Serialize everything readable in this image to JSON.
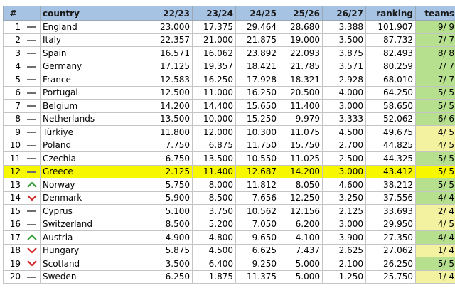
{
  "headers": {
    "num": "#",
    "country": "country",
    "y1": "22/23",
    "y2": "23/24",
    "y3": "24/25",
    "y4": "25/26",
    "y5": "26/27",
    "ranking": "ranking",
    "teams": "teams"
  },
  "rows": [
    {
      "num": "1",
      "trend": "same",
      "country": "England",
      "y1": "23.000",
      "y2": "17.375",
      "y3": "29.464",
      "y4": "28.680",
      "y5": "3.388",
      "ranking": "101.907",
      "teams": "9/ 9",
      "teams_status": "full"
    },
    {
      "num": "2",
      "trend": "same",
      "country": "Italy",
      "y1": "22.357",
      "y2": "21.000",
      "y3": "21.875",
      "y4": "19.000",
      "y5": "3.500",
      "ranking": "87.732",
      "teams": "7/ 7",
      "teams_status": "full"
    },
    {
      "num": "3",
      "trend": "same",
      "country": "Spain",
      "y1": "16.571",
      "y2": "16.062",
      "y3": "23.892",
      "y4": "22.093",
      "y5": "3.875",
      "ranking": "82.493",
      "teams": "8/ 8",
      "teams_status": "full"
    },
    {
      "num": "4",
      "trend": "same",
      "country": "Germany",
      "y1": "17.125",
      "y2": "19.357",
      "y3": "18.421",
      "y4": "21.785",
      "y5": "3.571",
      "ranking": "80.259",
      "teams": "7/ 7",
      "teams_status": "full"
    },
    {
      "num": "5",
      "trend": "same",
      "country": "France",
      "y1": "12.583",
      "y2": "16.250",
      "y3": "17.928",
      "y4": "18.321",
      "y5": "2.928",
      "ranking": "68.010",
      "teams": "7/ 7",
      "teams_status": "full"
    },
    {
      "num": "6",
      "trend": "same",
      "country": "Portugal",
      "y1": "12.500",
      "y2": "11.000",
      "y3": "16.250",
      "y4": "20.500",
      "y5": "4.000",
      "ranking": "64.250",
      "teams": "5/ 5",
      "teams_status": "full"
    },
    {
      "num": "7",
      "trend": "same",
      "country": "Belgium",
      "y1": "14.200",
      "y2": "14.400",
      "y3": "15.650",
      "y4": "11.400",
      "y5": "3.000",
      "ranking": "58.650",
      "teams": "5/ 5",
      "teams_status": "full"
    },
    {
      "num": "8",
      "trend": "same",
      "country": "Netherlands",
      "y1": "13.500",
      "y2": "10.000",
      "y3": "15.250",
      "y4": "9.979",
      "y5": "3.333",
      "ranking": "52.062",
      "teams": "6/ 6",
      "teams_status": "full"
    },
    {
      "num": "9",
      "trend": "same",
      "country": "Türkiye",
      "y1": "11.800",
      "y2": "12.000",
      "y3": "10.300",
      "y4": "11.075",
      "y5": "4.500",
      "ranking": "49.675",
      "teams": "4/ 5",
      "teams_status": "part"
    },
    {
      "num": "10",
      "trend": "same",
      "country": "Poland",
      "y1": "7.750",
      "y2": "6.875",
      "y3": "11.750",
      "y4": "15.750",
      "y5": "2.700",
      "ranking": "44.825",
      "teams": "4/ 5",
      "teams_status": "part"
    },
    {
      "num": "11",
      "trend": "same",
      "country": "Czechia",
      "y1": "6.750",
      "y2": "13.500",
      "y3": "10.550",
      "y4": "11.025",
      "y5": "2.500",
      "ranking": "44.325",
      "teams": "5/ 5",
      "teams_status": "full"
    },
    {
      "num": "12",
      "trend": "same",
      "country": "Greece",
      "y1": "2.125",
      "y2": "11.400",
      "y3": "12.687",
      "y4": "14.200",
      "y5": "3.000",
      "ranking": "43.412",
      "teams": "5/ 5",
      "teams_status": "full",
      "highlight": true
    },
    {
      "num": "13",
      "trend": "up",
      "country": "Norway",
      "y1": "5.750",
      "y2": "8.000",
      "y3": "11.812",
      "y4": "8.050",
      "y5": "4.600",
      "ranking": "38.212",
      "teams": "5/ 5",
      "teams_status": "full"
    },
    {
      "num": "14",
      "trend": "down",
      "country": "Denmark",
      "y1": "5.900",
      "y2": "8.500",
      "y3": "7.656",
      "y4": "12.250",
      "y5": "3.250",
      "ranking": "37.556",
      "teams": "4/ 4",
      "teams_status": "full"
    },
    {
      "num": "15",
      "trend": "same",
      "country": "Cyprus",
      "y1": "5.100",
      "y2": "3.750",
      "y3": "10.562",
      "y4": "12.156",
      "y5": "2.125",
      "ranking": "33.693",
      "teams": "2/ 4",
      "teams_status": "part"
    },
    {
      "num": "16",
      "trend": "same",
      "country": "Switzerland",
      "y1": "8.500",
      "y2": "5.200",
      "y3": "7.050",
      "y4": "6.200",
      "y5": "3.000",
      "ranking": "29.950",
      "teams": "4/ 5",
      "teams_status": "part"
    },
    {
      "num": "17",
      "trend": "up",
      "country": "Austria",
      "y1": "4.900",
      "y2": "4.800",
      "y3": "9.650",
      "y4": "4.100",
      "y5": "3.900",
      "ranking": "27.350",
      "teams": "4/ 4",
      "teams_status": "full"
    },
    {
      "num": "18",
      "trend": "down",
      "country": "Hungary",
      "y1": "5.875",
      "y2": "4.500",
      "y3": "6.625",
      "y4": "7.437",
      "y5": "2.625",
      "ranking": "27.062",
      "teams": "1/ 4",
      "teams_status": "part"
    },
    {
      "num": "19",
      "trend": "down",
      "country": "Scotland",
      "y1": "3.500",
      "y2": "6.400",
      "y3": "9.250",
      "y4": "5.000",
      "y5": "2.100",
      "ranking": "26.250",
      "teams": "5/ 5",
      "teams_status": "full"
    },
    {
      "num": "20",
      "trend": "same",
      "country": "Sweden",
      "y1": "6.250",
      "y2": "1.875",
      "y3": "11.375",
      "y4": "5.000",
      "y5": "1.250",
      "ranking": "25.750",
      "teams": "1/ 4",
      "teams_status": "part"
    }
  ],
  "colors": {
    "header_bg": "#a7c3e4",
    "teams_full": "#b6df8e",
    "teams_partial": "#f3f2a0",
    "highlight": "#f7f700",
    "trend_up": "#2e9a2e",
    "trend_down": "#d02020",
    "trend_same": "#6e6e6e"
  },
  "icons": {
    "same": "dash-icon",
    "up": "chevron-up-icon",
    "down": "chevron-down-icon"
  }
}
